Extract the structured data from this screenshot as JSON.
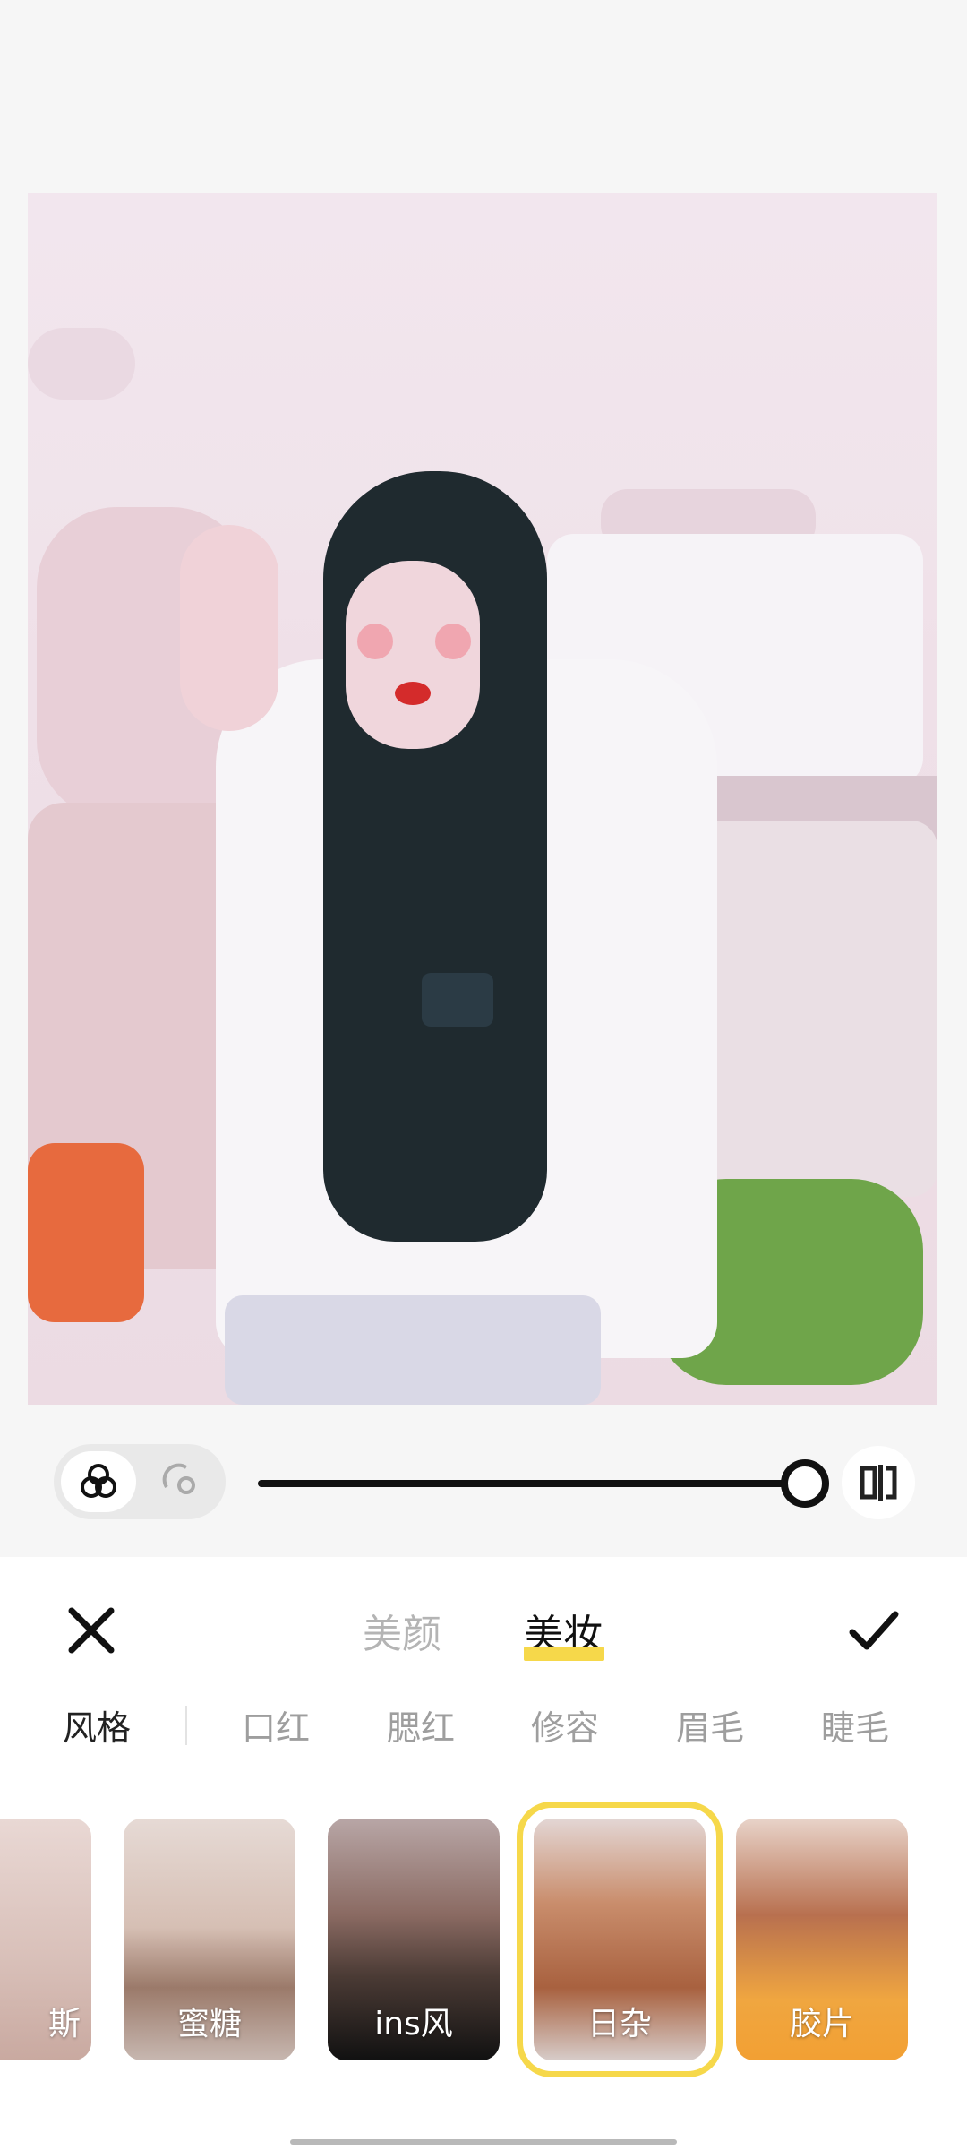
{
  "slider": {
    "value": 1.0
  },
  "tabs": [
    "美颜",
    "美妆"
  ],
  "active_tab": 1,
  "categories": [
    "风格",
    "口红",
    "腮红",
    "修容",
    "眉毛",
    "睫毛"
  ],
  "active_category": 0,
  "styles": [
    {
      "label": "斯"
    },
    {
      "label": "蜜糖"
    },
    {
      "label": "ins风"
    },
    {
      "label": "日杂"
    },
    {
      "label": "胶片"
    }
  ],
  "selected_style": 3,
  "colors": {
    "accent": "#f6d84a",
    "text": "#111111",
    "muted": "#b4b4b4"
  },
  "icons": {
    "close": "close-icon",
    "confirm": "check-icon",
    "face_mode": "face-overlap-icon",
    "face_detect": "face-scan-icon",
    "compare": "compare-icon"
  }
}
